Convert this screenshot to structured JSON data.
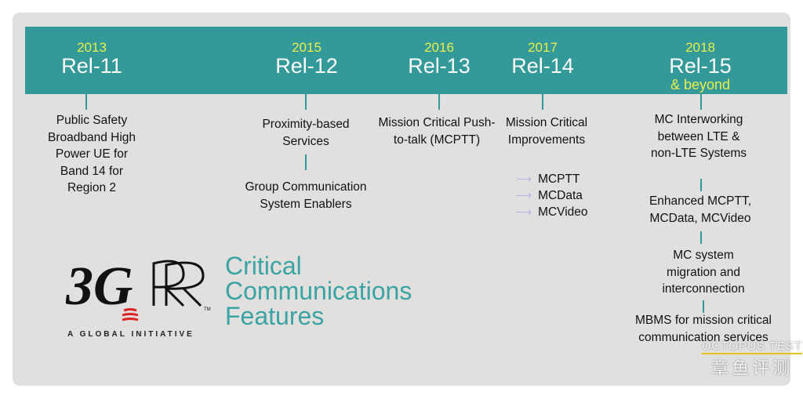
{
  "releases": [
    {
      "year": "2013",
      "name": "Rel-11",
      "items": [
        "Public Safety Broadband High Power UE for Band 14 for Region 2"
      ]
    },
    {
      "year": "2015",
      "name": "Rel-12",
      "items": [
        "Proximity-based Services",
        "Group Communication System Enablers"
      ]
    },
    {
      "year": "2016",
      "name": "Rel-13",
      "items": [
        "Mission Critical Push-to-talk (MCPTT)"
      ]
    },
    {
      "year": "2017",
      "name": "Rel-14",
      "items": [
        "Mission Critical Improvements"
      ],
      "subitems": [
        "MCPTT",
        "MCData",
        "MCVideo"
      ]
    },
    {
      "year": "2018",
      "name": "Rel-15",
      "suffix": "& beyond",
      "items": [
        "MC Interworking between LTE & non-LTE Systems",
        "Enhanced MCPTT, MCData, MCVideo",
        "MC system migration and interconnection",
        "MBMS for mission critical communication services"
      ]
    }
  ],
  "logo": {
    "text": "3GPP",
    "tm": "TM",
    "tagline": "A GLOBAL INITIATIVE"
  },
  "title_lines": [
    "Critical",
    "Communications",
    "Features"
  ],
  "watermark": {
    "line1": "OCTOPUS TEST",
    "line2": "章鱼评测"
  },
  "colors": {
    "banner": "#339999",
    "year": "#e8f04a",
    "title": "#3aa3a3",
    "arrow": "#b4b0ea"
  }
}
